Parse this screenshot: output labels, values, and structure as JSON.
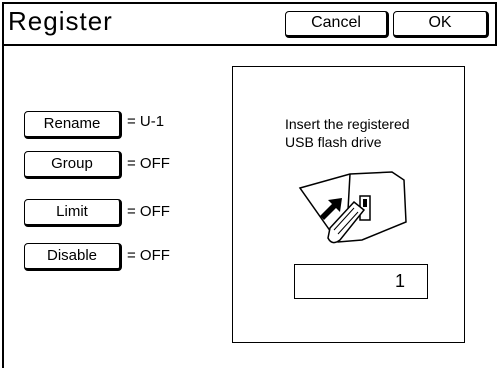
{
  "header": {
    "title": "Register",
    "cancel_label": "Cancel",
    "ok_label": "OK"
  },
  "settings": [
    {
      "button_label": "Rename",
      "value": "= U-1"
    },
    {
      "button_label": "Group",
      "value": "= OFF"
    },
    {
      "button_label": "Limit",
      "value": "= OFF"
    },
    {
      "button_label": "Disable",
      "value": "= OFF"
    }
  ],
  "panel": {
    "message": "Insert the registered\nUSB flash drive",
    "counter_value": "1",
    "illustration_icon": "usb-insert-icon"
  }
}
